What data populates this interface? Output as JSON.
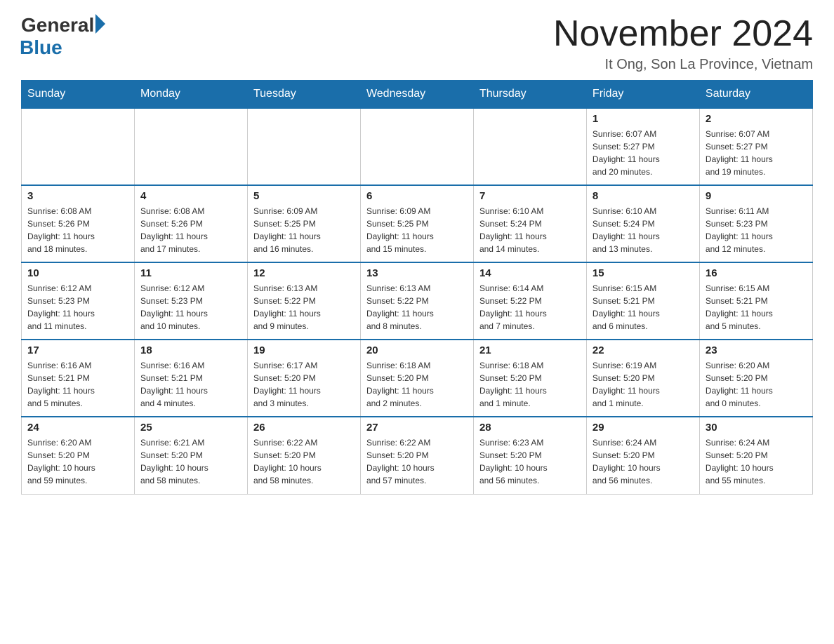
{
  "header": {
    "logo_general": "General",
    "logo_blue": "Blue",
    "month_title": "November 2024",
    "location": "It Ong, Son La Province, Vietnam"
  },
  "days_of_week": [
    "Sunday",
    "Monday",
    "Tuesday",
    "Wednesday",
    "Thursday",
    "Friday",
    "Saturday"
  ],
  "weeks": [
    [
      {
        "day": "",
        "info": ""
      },
      {
        "day": "",
        "info": ""
      },
      {
        "day": "",
        "info": ""
      },
      {
        "day": "",
        "info": ""
      },
      {
        "day": "",
        "info": ""
      },
      {
        "day": "1",
        "info": "Sunrise: 6:07 AM\nSunset: 5:27 PM\nDaylight: 11 hours\nand 20 minutes."
      },
      {
        "day": "2",
        "info": "Sunrise: 6:07 AM\nSunset: 5:27 PM\nDaylight: 11 hours\nand 19 minutes."
      }
    ],
    [
      {
        "day": "3",
        "info": "Sunrise: 6:08 AM\nSunset: 5:26 PM\nDaylight: 11 hours\nand 18 minutes."
      },
      {
        "day": "4",
        "info": "Sunrise: 6:08 AM\nSunset: 5:26 PM\nDaylight: 11 hours\nand 17 minutes."
      },
      {
        "day": "5",
        "info": "Sunrise: 6:09 AM\nSunset: 5:25 PM\nDaylight: 11 hours\nand 16 minutes."
      },
      {
        "day": "6",
        "info": "Sunrise: 6:09 AM\nSunset: 5:25 PM\nDaylight: 11 hours\nand 15 minutes."
      },
      {
        "day": "7",
        "info": "Sunrise: 6:10 AM\nSunset: 5:24 PM\nDaylight: 11 hours\nand 14 minutes."
      },
      {
        "day": "8",
        "info": "Sunrise: 6:10 AM\nSunset: 5:24 PM\nDaylight: 11 hours\nand 13 minutes."
      },
      {
        "day": "9",
        "info": "Sunrise: 6:11 AM\nSunset: 5:23 PM\nDaylight: 11 hours\nand 12 minutes."
      }
    ],
    [
      {
        "day": "10",
        "info": "Sunrise: 6:12 AM\nSunset: 5:23 PM\nDaylight: 11 hours\nand 11 minutes."
      },
      {
        "day": "11",
        "info": "Sunrise: 6:12 AM\nSunset: 5:23 PM\nDaylight: 11 hours\nand 10 minutes."
      },
      {
        "day": "12",
        "info": "Sunrise: 6:13 AM\nSunset: 5:22 PM\nDaylight: 11 hours\nand 9 minutes."
      },
      {
        "day": "13",
        "info": "Sunrise: 6:13 AM\nSunset: 5:22 PM\nDaylight: 11 hours\nand 8 minutes."
      },
      {
        "day": "14",
        "info": "Sunrise: 6:14 AM\nSunset: 5:22 PM\nDaylight: 11 hours\nand 7 minutes."
      },
      {
        "day": "15",
        "info": "Sunrise: 6:15 AM\nSunset: 5:21 PM\nDaylight: 11 hours\nand 6 minutes."
      },
      {
        "day": "16",
        "info": "Sunrise: 6:15 AM\nSunset: 5:21 PM\nDaylight: 11 hours\nand 5 minutes."
      }
    ],
    [
      {
        "day": "17",
        "info": "Sunrise: 6:16 AM\nSunset: 5:21 PM\nDaylight: 11 hours\nand 5 minutes."
      },
      {
        "day": "18",
        "info": "Sunrise: 6:16 AM\nSunset: 5:21 PM\nDaylight: 11 hours\nand 4 minutes."
      },
      {
        "day": "19",
        "info": "Sunrise: 6:17 AM\nSunset: 5:20 PM\nDaylight: 11 hours\nand 3 minutes."
      },
      {
        "day": "20",
        "info": "Sunrise: 6:18 AM\nSunset: 5:20 PM\nDaylight: 11 hours\nand 2 minutes."
      },
      {
        "day": "21",
        "info": "Sunrise: 6:18 AM\nSunset: 5:20 PM\nDaylight: 11 hours\nand 1 minute."
      },
      {
        "day": "22",
        "info": "Sunrise: 6:19 AM\nSunset: 5:20 PM\nDaylight: 11 hours\nand 1 minute."
      },
      {
        "day": "23",
        "info": "Sunrise: 6:20 AM\nSunset: 5:20 PM\nDaylight: 11 hours\nand 0 minutes."
      }
    ],
    [
      {
        "day": "24",
        "info": "Sunrise: 6:20 AM\nSunset: 5:20 PM\nDaylight: 10 hours\nand 59 minutes."
      },
      {
        "day": "25",
        "info": "Sunrise: 6:21 AM\nSunset: 5:20 PM\nDaylight: 10 hours\nand 58 minutes."
      },
      {
        "day": "26",
        "info": "Sunrise: 6:22 AM\nSunset: 5:20 PM\nDaylight: 10 hours\nand 58 minutes."
      },
      {
        "day": "27",
        "info": "Sunrise: 6:22 AM\nSunset: 5:20 PM\nDaylight: 10 hours\nand 57 minutes."
      },
      {
        "day": "28",
        "info": "Sunrise: 6:23 AM\nSunset: 5:20 PM\nDaylight: 10 hours\nand 56 minutes."
      },
      {
        "day": "29",
        "info": "Sunrise: 6:24 AM\nSunset: 5:20 PM\nDaylight: 10 hours\nand 56 minutes."
      },
      {
        "day": "30",
        "info": "Sunrise: 6:24 AM\nSunset: 5:20 PM\nDaylight: 10 hours\nand 55 minutes."
      }
    ]
  ]
}
